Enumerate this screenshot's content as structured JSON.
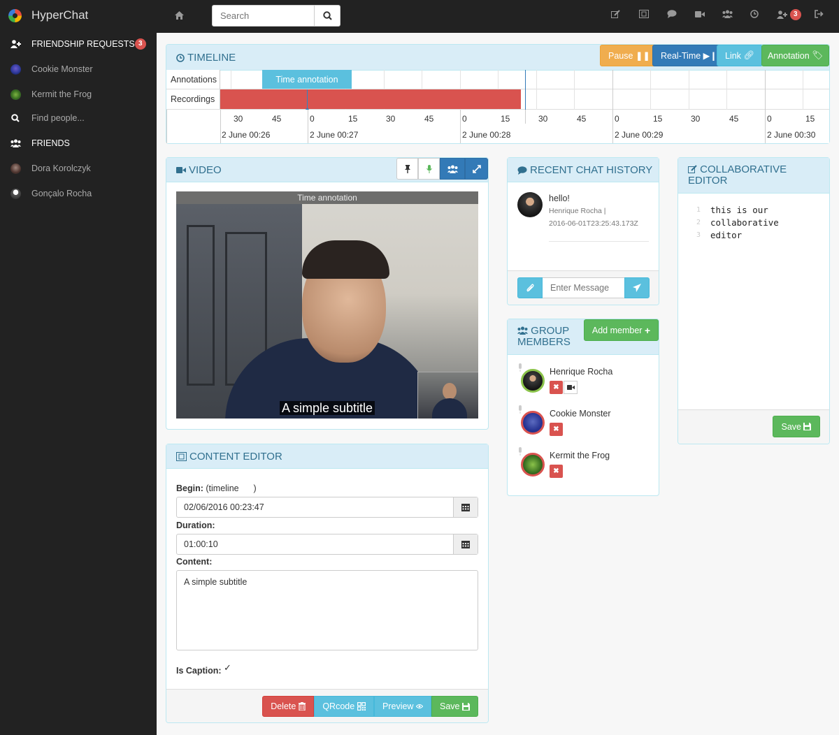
{
  "app": {
    "name": "HyperChat"
  },
  "topbar": {
    "search_placeholder": "Search",
    "friend_requests_count": "3"
  },
  "sidebar": {
    "friendship_requests": {
      "label": "FRIENDSHIP REQUESTS",
      "count": "3"
    },
    "requests": [
      {
        "label": "Cookie Monster"
      },
      {
        "label": "Kermit the Frog"
      }
    ],
    "find_people": "Find people...",
    "friends_header": "FRIENDS",
    "friends": [
      {
        "label": "Dora Korolczyk"
      },
      {
        "label": "Gonçalo Rocha"
      }
    ]
  },
  "timeline": {
    "title": "TIMELINE",
    "buttons": {
      "pause": "Pause",
      "realtime": "Real-Time",
      "link": "Link",
      "annotation": "Annotation"
    },
    "rows": {
      "annotations": "Annotations",
      "recordings": "Recordings"
    },
    "annotation_label": "Time annotation",
    "ticks": [
      "30",
      "45",
      "0",
      "15",
      "30",
      "45",
      "0",
      "15",
      "30",
      "45",
      "0",
      "15",
      "30",
      "45",
      "0",
      "15"
    ],
    "days": [
      "2 June 00:26",
      "2 June 00:27",
      "2 June 00:28",
      "2 June 00:29",
      "2 June 00:30"
    ]
  },
  "video": {
    "title": "VIDEO",
    "annotation_bar": "Time annotation",
    "subtitle": "A simple subtitle"
  },
  "content_editor": {
    "title": "CONTENT EDITOR",
    "begin_label": "Begin:",
    "begin_hint": "(timeline      )",
    "begin_value": "02/06/2016 00:23:47",
    "duration_label": "Duration:",
    "duration_value": "01:00:10",
    "content_label": "Content:",
    "content_value": "A simple subtitle",
    "is_caption_label": "Is Caption:",
    "is_caption": true,
    "buttons": {
      "delete": "Delete",
      "qrcode": "QRcode",
      "preview": "Preview",
      "save": "Save"
    }
  },
  "chat": {
    "title": "RECENT CHAT HISTORY",
    "messages": [
      {
        "text": "hello!",
        "author": "Henrique Rocha |",
        "timestamp": "2016-06-01T23:25:43.173Z"
      }
    ],
    "input_placeholder": "Enter Message"
  },
  "group": {
    "title_line1": "GROUP",
    "title_line2": "MEMBERS",
    "add_button": "Add member",
    "members": [
      {
        "name": "Henrique Rocha",
        "ring": "#8bc34a"
      },
      {
        "name": "Cookie Monster",
        "ring": "#d9534f"
      },
      {
        "name": "Kermit the Frog",
        "ring": "#d9534f"
      }
    ]
  },
  "collab": {
    "title_line1": "COLLABORATIVE",
    "title_line2": "EDITOR",
    "lines": [
      {
        "n": "1",
        "text": "this is our"
      },
      {
        "n": "2",
        "text": "collaborative"
      },
      {
        "n": "3",
        "text": "editor"
      }
    ],
    "save": "Save"
  },
  "colors": {
    "accent": "#337ab7",
    "panel_header": "#d9edf7",
    "panel_text": "#31708f",
    "recording": "#d9534f"
  }
}
